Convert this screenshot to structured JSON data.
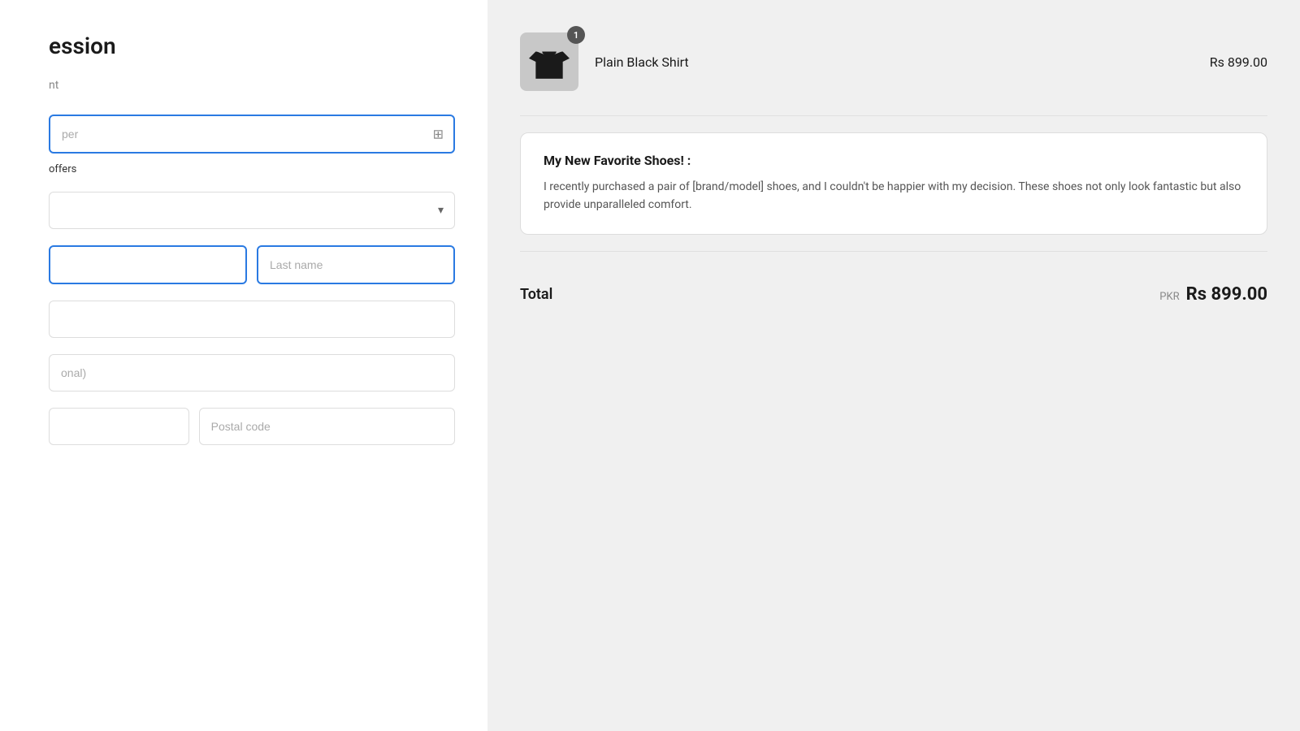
{
  "left": {
    "title": "ession",
    "subtitle": "nt",
    "coupon_placeholder": "per",
    "coupon_icon": "⊞",
    "offers_text": "offers",
    "country_placeholder": "",
    "first_name_placeholder": "",
    "last_name_placeholder": "Last name",
    "address_placeholder": "",
    "apartment_placeholder": "onal)",
    "city_placeholder": "",
    "postal_code_placeholder": "Postal code"
  },
  "right": {
    "product": {
      "name": "Plain Black Shirt",
      "price": "Rs 899.00",
      "quantity": "1"
    },
    "review": {
      "title": "My New Favorite Shoes! :",
      "body": "I recently purchased a pair of [brand/model] shoes, and I couldn't be happier with my decision. These shoes not only look fantastic but also provide unparalleled comfort."
    },
    "total": {
      "label": "Total",
      "currency_code": "PKR",
      "amount": "Rs 899.00"
    }
  }
}
